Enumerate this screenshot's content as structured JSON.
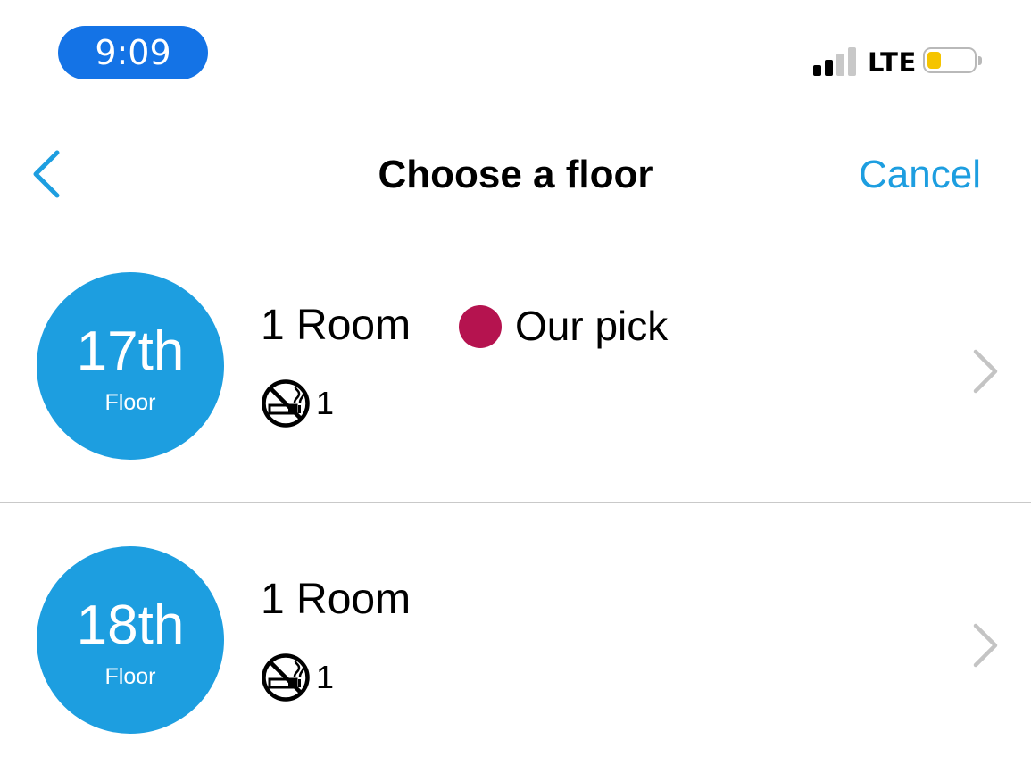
{
  "status_bar": {
    "time": "9:09",
    "network": "LTE",
    "signal_bars_active": 2,
    "signal_bars_total": 4,
    "battery_level": 0.3,
    "colors": {
      "time_pill": "#1473e6",
      "battery_fill": "#f5c400",
      "signal_active": "#000000",
      "signal_inactive": "#c8c8c8"
    }
  },
  "nav": {
    "back_icon": "chevron-left-icon",
    "title": "Choose a floor",
    "cancel_label": "Cancel",
    "accent_color": "#1d9ee0"
  },
  "floors": [
    {
      "number": "17th",
      "label": "Floor",
      "rooms": "1 Room",
      "pick_label": "Our pick",
      "non_smoking_icon": "no-smoking-icon",
      "non_smoking_count": "1"
    },
    {
      "number": "18th",
      "label": "Floor",
      "rooms": "1 Room",
      "non_smoking_icon": "no-smoking-icon",
      "non_smoking_count": "1"
    }
  ],
  "colors": {
    "badge": "#1d9ee0",
    "pick_dot": "#b5134f",
    "chevron": "#c4c4c4",
    "divider": "#c9c9c9"
  }
}
